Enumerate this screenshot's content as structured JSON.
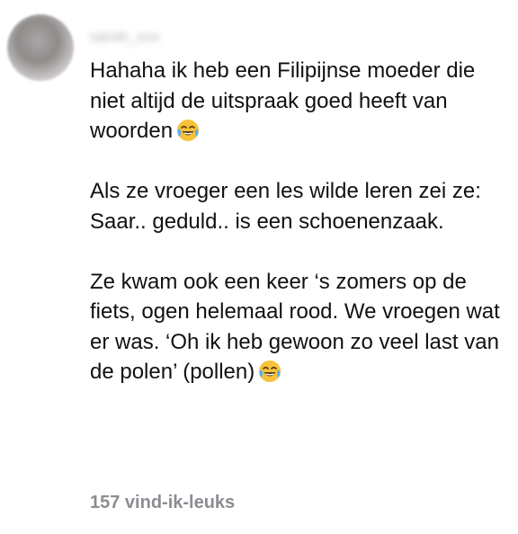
{
  "comment": {
    "author": "sarah_xxx",
    "paragraphs": [
      {
        "text": "Hahaha ik heb een Filipijnse moeder die niet altijd de uitspraak goed heeft van woorden",
        "emoji": "face-with-tears-of-joy"
      },
      {
        "text": "Als ze vroeger een les wilde leren zei ze: Saar.. geduld.. is een schoenenzaak.",
        "emoji": null
      },
      {
        "text": "Ze kwam ook een keer ‘s zomers op de fiets, ogen helemaal rood. We vroegen wat er was. ‘Oh ik heb gewoon zo veel last van de polen’ (pollen)",
        "emoji": "face-with-tears-of-joy"
      }
    ],
    "likes_label": "157 vind-ik-leuks"
  },
  "colors": {
    "text": "#111111",
    "meta": "#8a8d91",
    "emoji_face": "#f7c23a"
  }
}
